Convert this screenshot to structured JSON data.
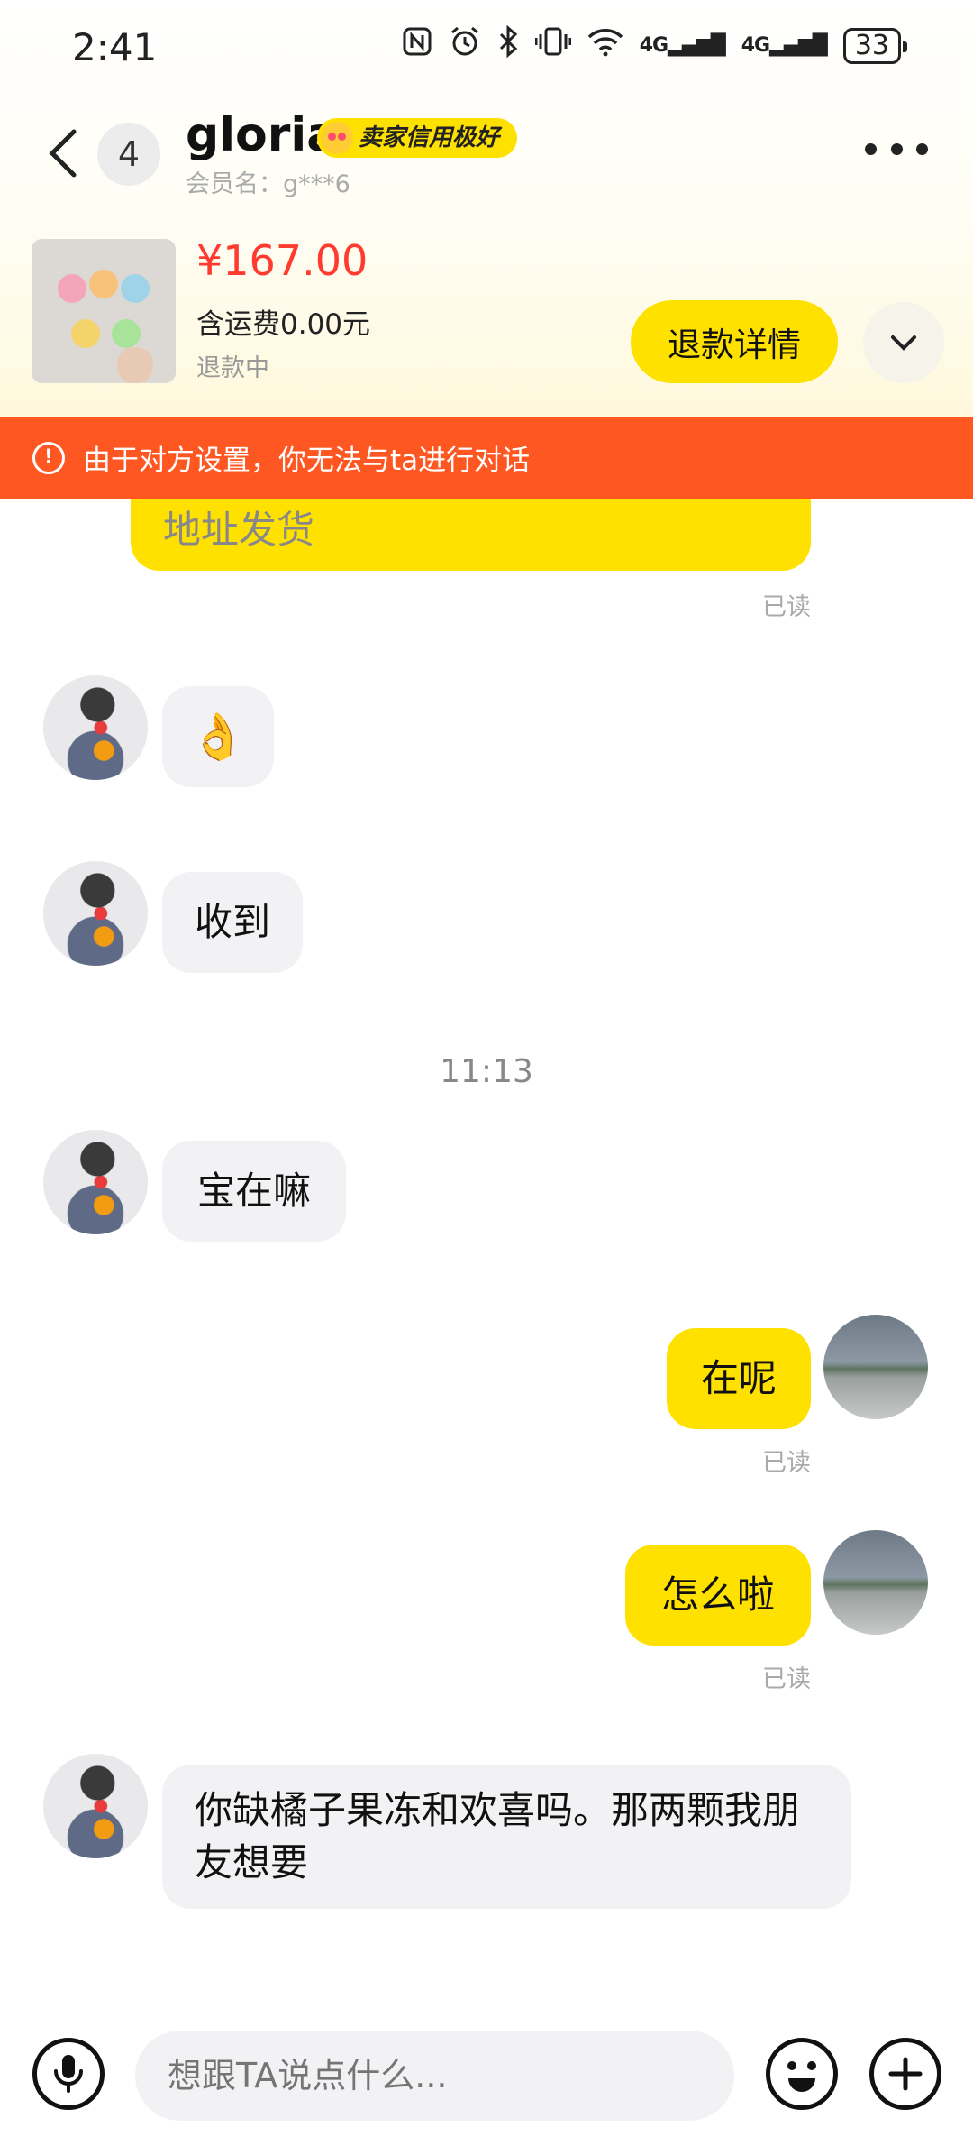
{
  "status_bar": {
    "time": "2:41",
    "network_1": "4G",
    "network_2": "4G",
    "battery": "33"
  },
  "header": {
    "unread_count": "4",
    "contact_name": "gloria",
    "credit_badge": "卖家信用极好",
    "member_id": "会员名：g***6"
  },
  "product": {
    "price": "¥167.00",
    "shipping": "含运费0.00元",
    "status": "退款中",
    "refund_button": "退款详情"
  },
  "warning": "由于对方设置，你无法与ta进行对话",
  "messages": [
    {
      "side": "out",
      "text": "地址发货",
      "read": "已读"
    },
    {
      "side": "in",
      "text": "👌"
    },
    {
      "side": "in",
      "text": "收到"
    },
    {
      "time_divider": "11:13"
    },
    {
      "side": "in",
      "text": "宝在嘛"
    },
    {
      "side": "out",
      "text": "在呢",
      "read": "已读"
    },
    {
      "side": "out",
      "text": "怎么啦",
      "read": "已读"
    },
    {
      "side": "in",
      "text": "你缺橘子果冻和欢喜吗。那两颗我朋友想要"
    }
  ],
  "input": {
    "placeholder": "想跟TA说点什么..."
  },
  "colors": {
    "accent": "#ffe100",
    "warning": "#ff5722",
    "price": "#ff3b30"
  }
}
